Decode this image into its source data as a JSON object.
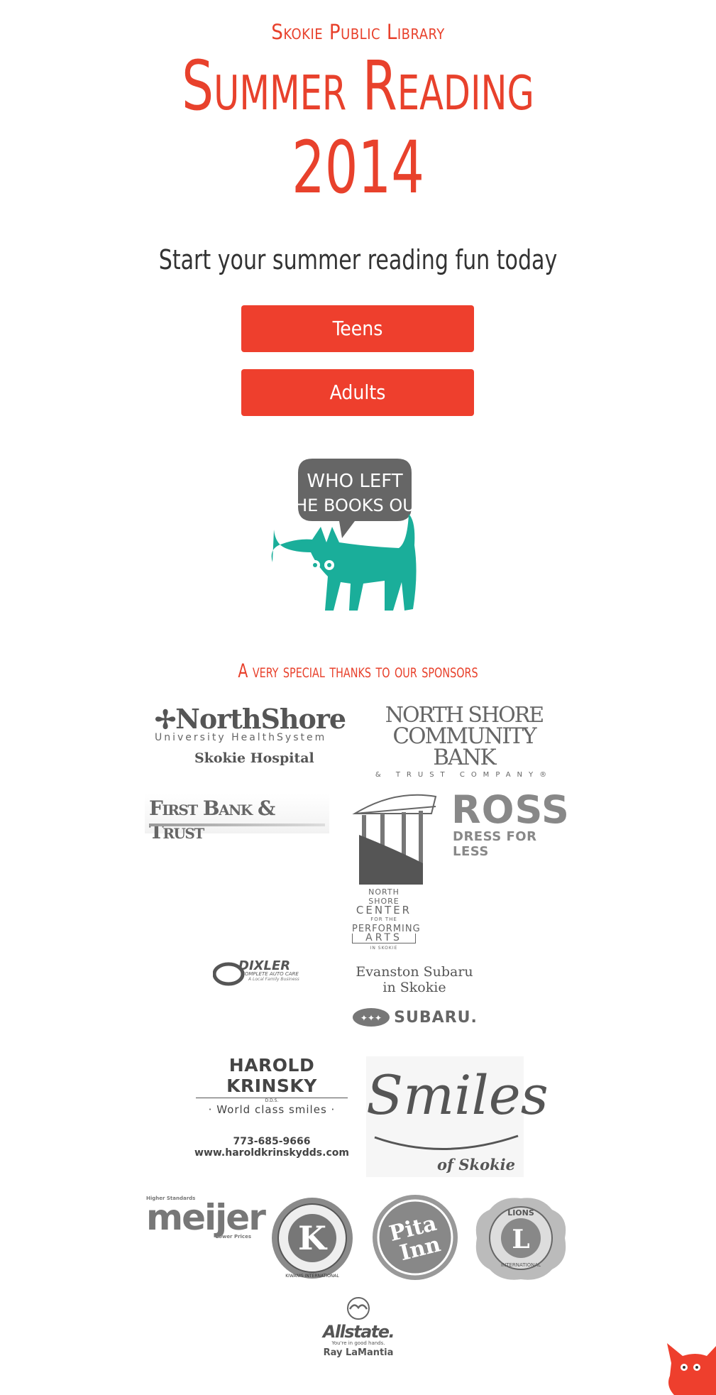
{
  "header": {
    "library_name": "Skokie Public Library",
    "title_line1": "Summer Reading",
    "title_line2": "2014",
    "tagline": "Start your summer reading fun today"
  },
  "buttons": {
    "teens": "Teens",
    "adults": "Adults"
  },
  "mascot": {
    "speech_line1": "WHO LEFT",
    "speech_line2": "THE BOOKS OUT"
  },
  "sponsors": {
    "heading": "A very special thanks to our sponsors",
    "northshore_uhs": {
      "name": "NorthShore",
      "sub": "University HealthSystem",
      "hospital": "Skokie Hospital"
    },
    "northshore_bank": {
      "line1": "North Shore",
      "line2": "Community Bank",
      "line3": "& TRUST COMPANY®"
    },
    "first_bank": "First Bank & Trust",
    "performing_arts": {
      "line1": "NORTH SHORE",
      "line2": "CENTER",
      "line3": "FOR THE",
      "line4": "PERFORMING",
      "line5": "ARTS",
      "line6": "IN SKOKIE"
    },
    "ross": {
      "name": "ROSS",
      "tagline": "DRESS FOR LESS"
    },
    "dixler": {
      "name": "DIXLER",
      "sub": "COMPLETE AUTO CARE",
      "sub2": "A Local Family Business"
    },
    "subaru": {
      "line1": "Evanston Subaru",
      "line2": "in Skokie",
      "brand": "SUBARU."
    },
    "krinsky": {
      "name": "HAROLD KRINSKY",
      "dds": "D.D.S.",
      "tagline": "· World class smiles ·",
      "phone": "773-685-9666",
      "url": "www.haroldkrinskydds.com"
    },
    "smiles": {
      "name": "Smiles",
      "sub": "of Skokie"
    },
    "meijer": {
      "top": "Higher Standards",
      "name": "meijer",
      "bottom": "Lower Prices"
    },
    "kiwanis": {
      "letter": "K",
      "ring": "KIWANIS INTERNATIONAL"
    },
    "pita": {
      "line1": "Pita",
      "line2": "Inn"
    },
    "lions": {
      "letter": "L",
      "top": "LIONS",
      "bottom": "INTERNATIONAL"
    },
    "allstate": {
      "name": "Allstate.",
      "tagline": "You're in good hands.",
      "agent": "Ray LaMantia"
    }
  }
}
